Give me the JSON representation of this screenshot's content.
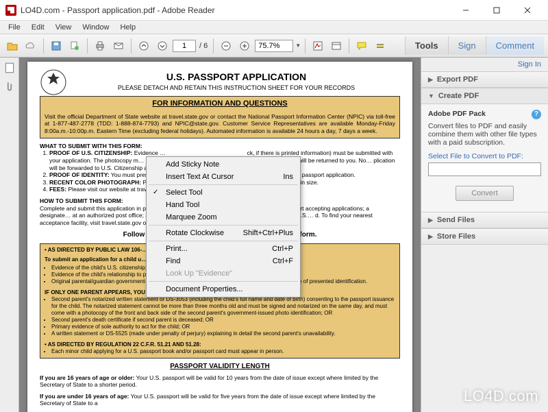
{
  "window": {
    "title": "LO4D.com - Passport application.pdf - Adobe Reader"
  },
  "menubar": [
    "File",
    "Edit",
    "View",
    "Window",
    "Help"
  ],
  "toolbar": {
    "page_current": "1",
    "page_total": "/ 6",
    "zoom": "75.7%"
  },
  "rtabs": {
    "tools": "Tools",
    "sign": "Sign",
    "comment": "Comment"
  },
  "rpanel": {
    "signin": "Sign In",
    "export": "Export PDF",
    "create": "Create PDF",
    "send": "Send Files",
    "store": "Store Files",
    "pack_title": "Adobe PDF Pack",
    "pack_desc": "Convert files to PDF and easily combine them with other file types with a paid subscription.",
    "select_label": "Select File to Convert to PDF:",
    "convert_btn": "Convert"
  },
  "doc": {
    "h1": "U.S. PASSPORT APPLICATION",
    "sub": "PLEASE DETACH AND RETAIN THIS INSTRUCTION SHEET FOR YOUR RECORDS",
    "info_head": "FOR INFORMATION AND QUESTIONS",
    "info_body": "Visit the official Department of State website at travel.state.gov or contact the National Passport Information Center (NPIC) via toll-free at 1-877-487-2778 (TDD: 1-888-874-7793) and NPIC@state.gov.  Customer Service Representatives are available Monday-Friday 8:00a.m.-10:00p.m. Eastern Time (excluding federal holidays). Automated information is available 24 hours a day, 7 days a week.",
    "what_head": "WHAT TO SUBMIT WITH THIS FORM:",
    "what1a": "PROOF OF U.S. CITIZENSHIP:",
    "what1b": " Evidence …",
    "what1c": "ck, if there is printed information) must be submitted with your application. The photocopy m… and clear. Evidence that is not damaged, altered, or forged will be returned to you. No… plication will be forwarded to U.S. Citizenship and Immigration Services, if we determine th…",
    "what2a": "PROOF OF IDENTITY:",
    "what2b": " You must prese…",
    "what2c": "front and back with your passport application.",
    "what3a": "RECENT COLOR PHOTOGRAPH:",
    "what3b": " Ph…",
    "what3c": "the face and 2x2 inches in size.",
    "what4a": "FEES:",
    "what4b": " Please visit our website at trav…",
    "how_head": "HOW TO SUBMIT THIS FORM:",
    "how_body1": "Complete and submit this application in pe… state court of record or a judge or clerk of a probate court accepting applications; a designate… at an authorized post office; an agent at a passport agency (by appointment only); or a U.S.… d.  To find your nearest acceptance facility, visit ",
    "how_link": "travel.state.gov",
    "how_body2": " or contact the National Pa…",
    "follow": "Follow the instructions on …n and submission of this form.",
    "tan1_head": "AS DIRECTED BY PUBLIC LAW 106-…",
    "tan1_line": "To submit an application for a child u… ust appear and present the following:",
    "tan1_b1": "Evidence of the child's U.S. citizenship;",
    "tan1_b2": "Evidence of the child's relationship to parents/guardian(s); AND",
    "tan1_b3": "Original parental/guardian government-issued identification AND a photocopy of the front and back side of presented identification.",
    "tan2_head": "IF ONLY ONE PARENT APPEARS, YOU MUST ALSO SUBMIT ONE OF THE FOLLOWING:",
    "tan2_b1": "Second parent's notarized written statement or DS-3053 (including the child's full name and date of birth) consenting to the passport issuance for the child. The notarized statement cannot be more than three months old and must be signed and notarized on the same day, and must come with a photocopy of the front and back side of the second parent's government-issued photo identification; OR",
    "tan2_b2": "Second parent's death certificate if second parent is deceased; OR",
    "tan2_b3": "Primary evidence of sole authority to act for the child; OR",
    "tan2_b4": "A written statement or DS-5525 (made under penalty of perjury) explaining in detail the second parent's unavailability.",
    "tan3_head": "AS DIRECTED BY REGULATION 22 C.F.R. 51.21 AND 51.28:",
    "tan3_b1": "Each minor child applying for a U.S. passport book and/or passport card must appear in person.",
    "pvl": "PASSPORT VALIDITY LENGTH",
    "pvl1": "If you are 16 years of age or older: Your U.S. passport will be valid for 10 years from the date of issue except where limited by the Secretary of State to a shorter period.",
    "pvl2": "If you are under 16 years of age: Your U.S. passport will be valid for five years from the date of issue except where limited by the Secretary of State to a"
  },
  "ctx": {
    "sticky": "Add Sticky Note",
    "insert": "Insert Text At Cursor",
    "insert_k": "Ins",
    "select": "Select Tool",
    "hand": "Hand Tool",
    "marquee": "Marquee Zoom",
    "rotate": "Rotate Clockwise",
    "rotate_k": "Shift+Ctrl+Plus",
    "print": "Print...",
    "print_k": "Ctrl+P",
    "find": "Find",
    "find_k": "Ctrl+F",
    "lookup": "Look Up \"Evidence\"",
    "props": "Document Properties..."
  },
  "watermark": "LO4D.com"
}
